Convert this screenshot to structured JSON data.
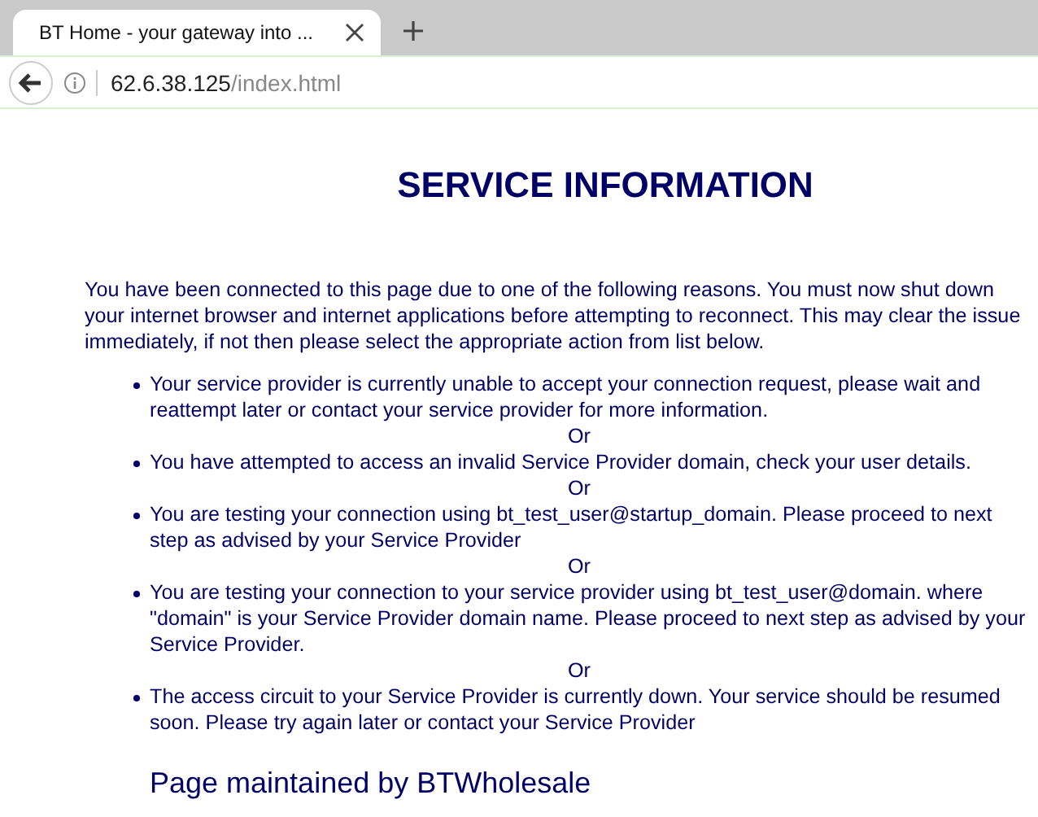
{
  "browser": {
    "tab": {
      "title": "BT Home - your gateway into ...",
      "selected": true
    },
    "url_host": "62.6.38.125",
    "url_path": "/index.html"
  },
  "page": {
    "heading": "SERVICE INFORMATION",
    "intro": "You have been connected to this page due to one of the following reasons. You must now shut down your internet browser and internet applications before attempting to reconnect. This may clear the issue immediately, if not then please select the appropriate action from list below.",
    "items": [
      {
        "kind": "reason",
        "text": "Your service provider is currently unable to accept your connection request, please wait and reattempt later or contact your service provider for more information."
      },
      {
        "kind": "separator",
        "text": "Or"
      },
      {
        "kind": "reason",
        "text": "You have attempted to access an invalid Service Provider domain, check your user details."
      },
      {
        "kind": "separator",
        "text": "Or"
      },
      {
        "kind": "reason",
        "text": "You are testing your connection using bt_test_user@startup_domain. Please proceed to next step as advised by your Service Provider"
      },
      {
        "kind": "separator",
        "text": "Or"
      },
      {
        "kind": "reason",
        "text": "You are testing your connection to your service provider using bt_test_user@domain. where \"domain\" is your Service Provider domain name. Please proceed to next step as advised by your Service Provider."
      },
      {
        "kind": "separator",
        "text": "Or"
      },
      {
        "kind": "reason",
        "text": "The access circuit to your Service Provider is currently down. Your service should be resumed soon. Please try again later or contact your Service Provider"
      }
    ],
    "footer": "Page maintained by BTWholesale"
  }
}
